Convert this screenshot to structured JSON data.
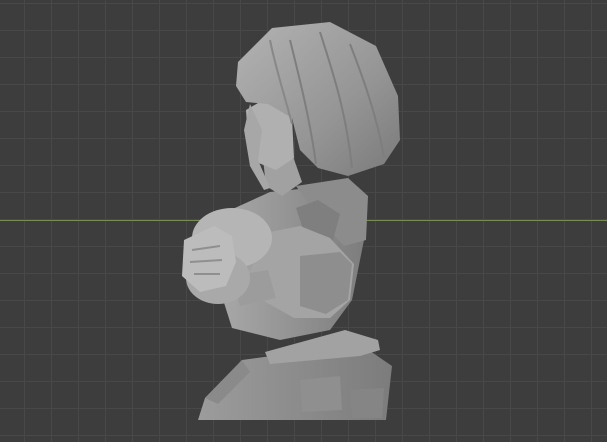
{
  "viewport": {
    "background_color": "#3d3d3d",
    "grid_color": "#484848",
    "x_axis_color": "#6f9a2b",
    "model_color": "#9a9a9a"
  },
  "model": {
    "subject": "sculpted-bust"
  }
}
